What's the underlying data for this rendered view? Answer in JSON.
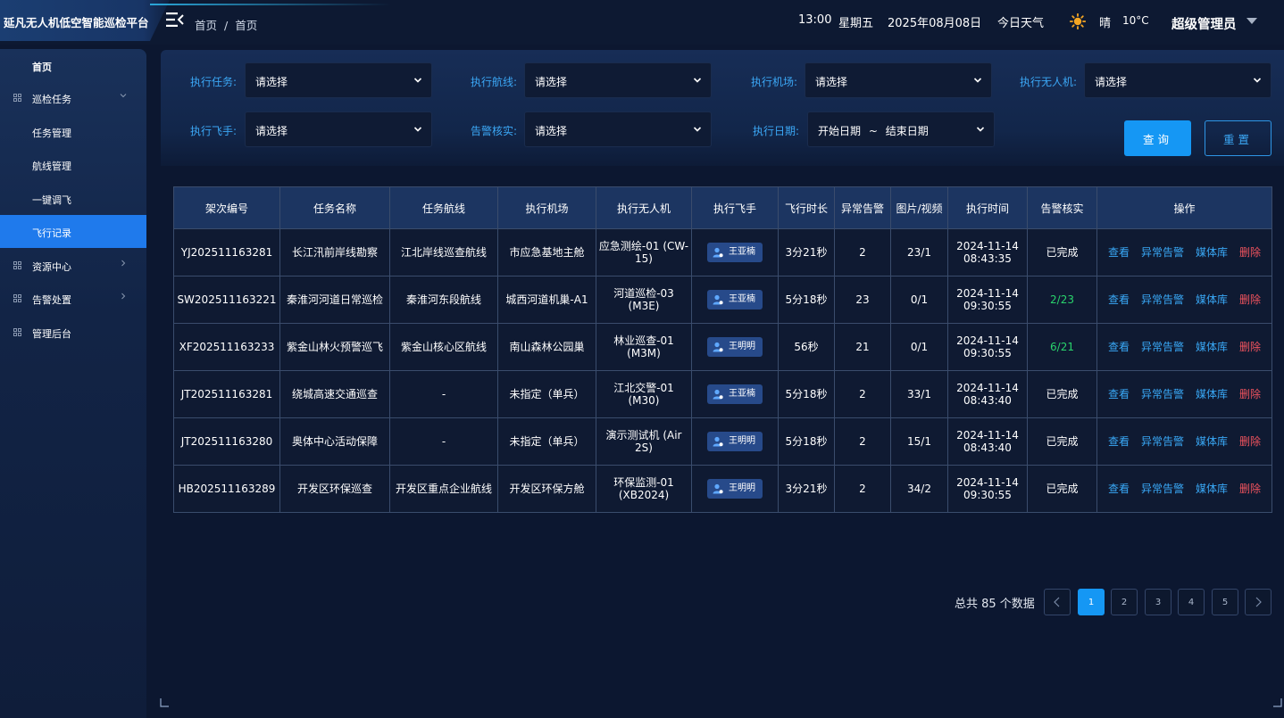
{
  "app": {
    "title": "延凡无人机低空智能巡检平台"
  },
  "breadcrumb": [
    "首页",
    "/",
    "首页"
  ],
  "header": {
    "time": "13:00",
    "weekday": "星期五",
    "date": "2025年08月08日",
    "weather_label": "今日天气",
    "weather_condition": "晴",
    "temperature": "10°C",
    "user": "超级管理员"
  },
  "sidebar": {
    "items": [
      {
        "label": "首页",
        "level": 1,
        "icon": "none"
      },
      {
        "label": "巡检任务",
        "level": 1,
        "icon": "grid",
        "arrow": "down"
      },
      {
        "label": "任务管理",
        "level": 2
      },
      {
        "label": "航线管理",
        "level": 2
      },
      {
        "label": "一键调飞",
        "level": 2
      },
      {
        "label": "飞行记录",
        "level": 2,
        "active": true
      },
      {
        "label": "资源中心",
        "level": 1,
        "icon": "grid",
        "arrow": "right"
      },
      {
        "label": "告警处置",
        "level": 1,
        "icon": "grid",
        "arrow": "right"
      },
      {
        "label": "管理后台",
        "level": 1,
        "icon": "grid"
      }
    ]
  },
  "filters": {
    "task": {
      "label": "执行任务:",
      "value": "请选择"
    },
    "route": {
      "label": "执行航线:",
      "value": "请选择"
    },
    "airport": {
      "label": "执行机场:",
      "value": "请选择"
    },
    "drone": {
      "label": "执行无人机:",
      "value": "请选择"
    },
    "pilot": {
      "label": "执行飞手:",
      "value": "请选择"
    },
    "alarm_verify": {
      "label": "告警核实:",
      "value": "请选择"
    },
    "date": {
      "label": "执行日期:",
      "start": "开始日期",
      "sep": "~",
      "end": "结束日期"
    },
    "query_label": "查询",
    "reset_label": "重置"
  },
  "table": {
    "headers": [
      "架次编号",
      "任务名称",
      "任务航线",
      "执行机场",
      "执行无人机",
      "执行飞手",
      "飞行时长",
      "异常告警",
      "图片/视频",
      "执行时间",
      "告警核实",
      "操作"
    ],
    "ops": [
      "查看",
      "异常告警",
      "媒体库",
      "删除"
    ],
    "rows": [
      {
        "id": "YJ202511163281",
        "task": "长江汛前岸线勘察",
        "route": "江北岸线巡查航线",
        "airport": "市应急基地主舱",
        "drone": "应急测绘-01 (CW-15)",
        "pilot": "王亚楠",
        "duration": "3分21秒",
        "alarms": "2",
        "media": "23/1",
        "time_date": "2024-11-14",
        "time_clock": "08:43:35",
        "verify": "已完成",
        "verify_highlight": false
      },
      {
        "id": "SW202511163221",
        "task": "秦淮河河道日常巡检",
        "route": "秦淮河东段航线",
        "airport": "城西河道机巢-A1",
        "drone": "河道巡检-03 (M3E)",
        "pilot": "王亚楠",
        "duration": "5分18秒",
        "alarms": "23",
        "media": "0/1",
        "time_date": "2024-11-14",
        "time_clock": "09:30:55",
        "verify": "2/23",
        "verify_highlight": true
      },
      {
        "id": "XF202511163233",
        "task": "紫金山林火预警巡飞",
        "route": "紫金山核心区航线",
        "airport": "南山森林公园巢",
        "drone": "林业巡查-01 (M3M)",
        "pilot": "王明明",
        "duration": "56秒",
        "alarms": "21",
        "media": "0/1",
        "time_date": "2024-11-14",
        "time_clock": "09:30:55",
        "verify": "6/21",
        "verify_highlight": true
      },
      {
        "id": "JT202511163281",
        "task": "绕城高速交通巡查",
        "route": "-",
        "airport": "未指定（单兵）",
        "drone": "江北交警-01 (M30)",
        "pilot": "王亚楠",
        "duration": "5分18秒",
        "alarms": "2",
        "media": "33/1",
        "time_date": "2024-11-14",
        "time_clock": "08:43:40",
        "verify": "已完成",
        "verify_highlight": false
      },
      {
        "id": "JT202511163280",
        "task": "奥体中心活动保障",
        "route": "-",
        "airport": "未指定（单兵）",
        "drone": "演示测试机 (Air 2S)",
        "pilot": "王明明",
        "duration": "5分18秒",
        "alarms": "2",
        "media": "15/1",
        "time_date": "2024-11-14",
        "time_clock": "08:43:40",
        "verify": "已完成",
        "verify_highlight": false
      },
      {
        "id": "HB202511163289",
        "task": "开发区环保巡查",
        "route": "开发区重点企业航线",
        "airport": "开发区环保方舱",
        "drone": "环保监测-01 (XB2024)",
        "pilot": "王明明",
        "duration": "3分21秒",
        "alarms": "2",
        "media": "34/2",
        "time_date": "2024-11-14",
        "time_clock": "09:30:55",
        "verify": "已完成",
        "verify_highlight": false
      }
    ]
  },
  "pagination": {
    "total_text": "总共 85 个数据",
    "prev": "<",
    "next": ">",
    "pages": [
      "1",
      "2",
      "3",
      "4",
      "5"
    ],
    "current": "1"
  },
  "colors": {
    "accent": "#1597f4",
    "link": "#39a8f6",
    "danger": "#f0535e",
    "success": "#29d36c",
    "background": "#0c1730"
  }
}
